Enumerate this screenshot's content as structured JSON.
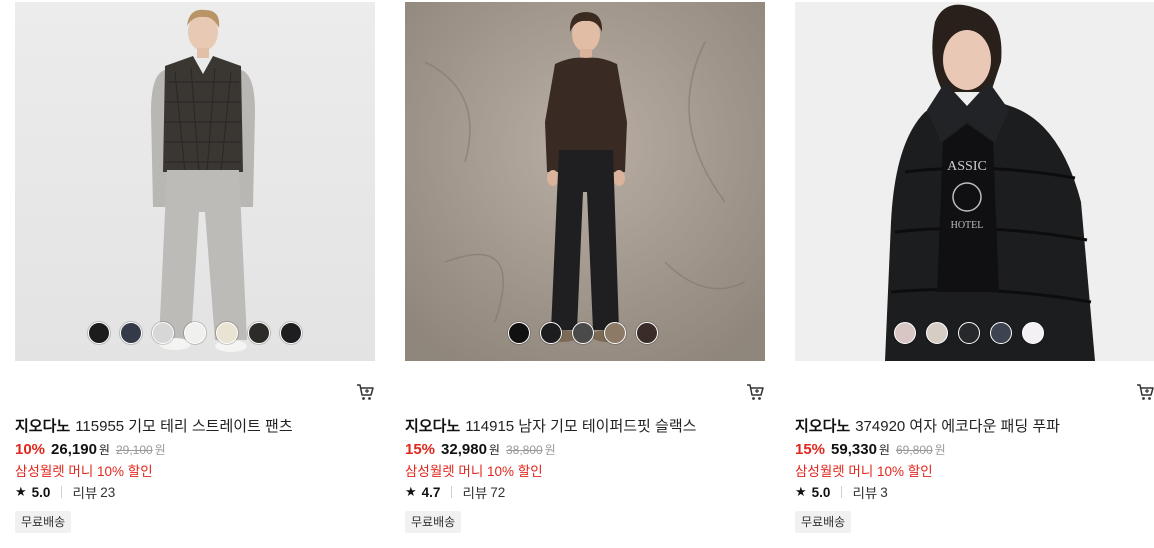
{
  "products": [
    {
      "brand": "지오다노",
      "name": "115955 기모 테리 스트레이트 팬츠",
      "discount": "10%",
      "price": "26,190",
      "currency": "원",
      "original_price": "29,100",
      "original_currency": "원",
      "promo": "삼성월렛 머니 10% 할인",
      "rating": "5.0",
      "review_label": "리뷰",
      "review_count": "23",
      "badge": "무료배송",
      "swatches": [
        "#1c1c1c",
        "#343a48",
        "#d7d7d7",
        "#f0f0ee",
        "#e8e3d2",
        "#2c2b28",
        "#1e1e21"
      ]
    },
    {
      "brand": "지오다노",
      "name": "114915 남자 기모 테이퍼드핏 슬랙스",
      "discount": "15%",
      "price": "32,980",
      "currency": "원",
      "original_price": "38,800",
      "original_currency": "원",
      "promo": "삼성월렛 머니 10% 할인",
      "rating": "4.7",
      "review_label": "리뷰",
      "review_count": "72",
      "badge": "무료배송",
      "swatches": [
        "#111111",
        "#1d1d1f",
        "#4a4a4a",
        "#8c7a66",
        "#3a2d28"
      ]
    },
    {
      "brand": "지오다노",
      "name": "374920 여자 에코다운 패딩 푸파",
      "discount": "15%",
      "price": "59,330",
      "currency": "원",
      "original_price": "69,800",
      "original_currency": "원",
      "promo": "삼성월렛 머니 10% 할인",
      "rating": "5.0",
      "review_label": "리뷰",
      "review_count": "3",
      "badge": "무료배송",
      "swatches": [
        "#d7c6c4",
        "#d6cdc5",
        "#26282b",
        "#3c4452",
        "#f3f1f3"
      ]
    }
  ]
}
